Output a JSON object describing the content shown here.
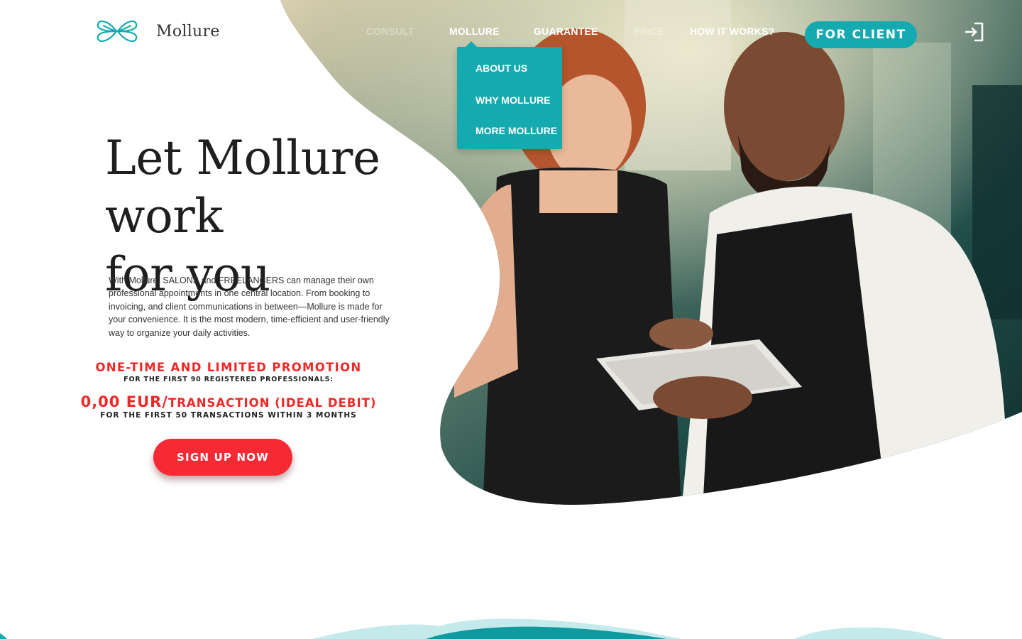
{
  "brand": {
    "name": "Mollure"
  },
  "nav": {
    "items": [
      {
        "label": "CONSULT"
      },
      {
        "label": "MOLLURE"
      },
      {
        "label": "GUARANTEE"
      },
      {
        "label": "PRICE"
      },
      {
        "label": "HOW IT WORKS?"
      }
    ],
    "dropdown": [
      "ABOUT US",
      "WHY MOLLURE",
      "MORE MOLLURE"
    ],
    "cta": "FOR CLIENT"
  },
  "hero": {
    "headline_line1": "Let Mollure work",
    "headline_line2": "for you",
    "description": "With Mollure, SALONS and FREELANCERS can manage their own professional appointments in one central location. From booking to invoicing, and client communications in between—Mollure is made for your convenience. It is the most modern, time-efficient and user-friendly way to organize your daily activities.",
    "promo_title": "ONE-TIME AND LIMITED PROMOTION",
    "promo_subtitle": "FOR THE FIRST 90 REGISTERED PROFESSIONALS:",
    "price_amount": "0,00 EUR/",
    "price_unit": "TRANSACTION (IDEAL DEBIT)",
    "promo_footnote": "FOR THE FIRST 50 TRANSACTIONS WITHIN 3 MONTHS",
    "signup_label": "SIGN UP NOW"
  },
  "colors": {
    "accent": "#14aab0",
    "promo_red": "#f02828",
    "signup_red": "#f52a35"
  },
  "icons": {
    "logo": "butterfly-logo-icon",
    "login": "login-icon"
  }
}
